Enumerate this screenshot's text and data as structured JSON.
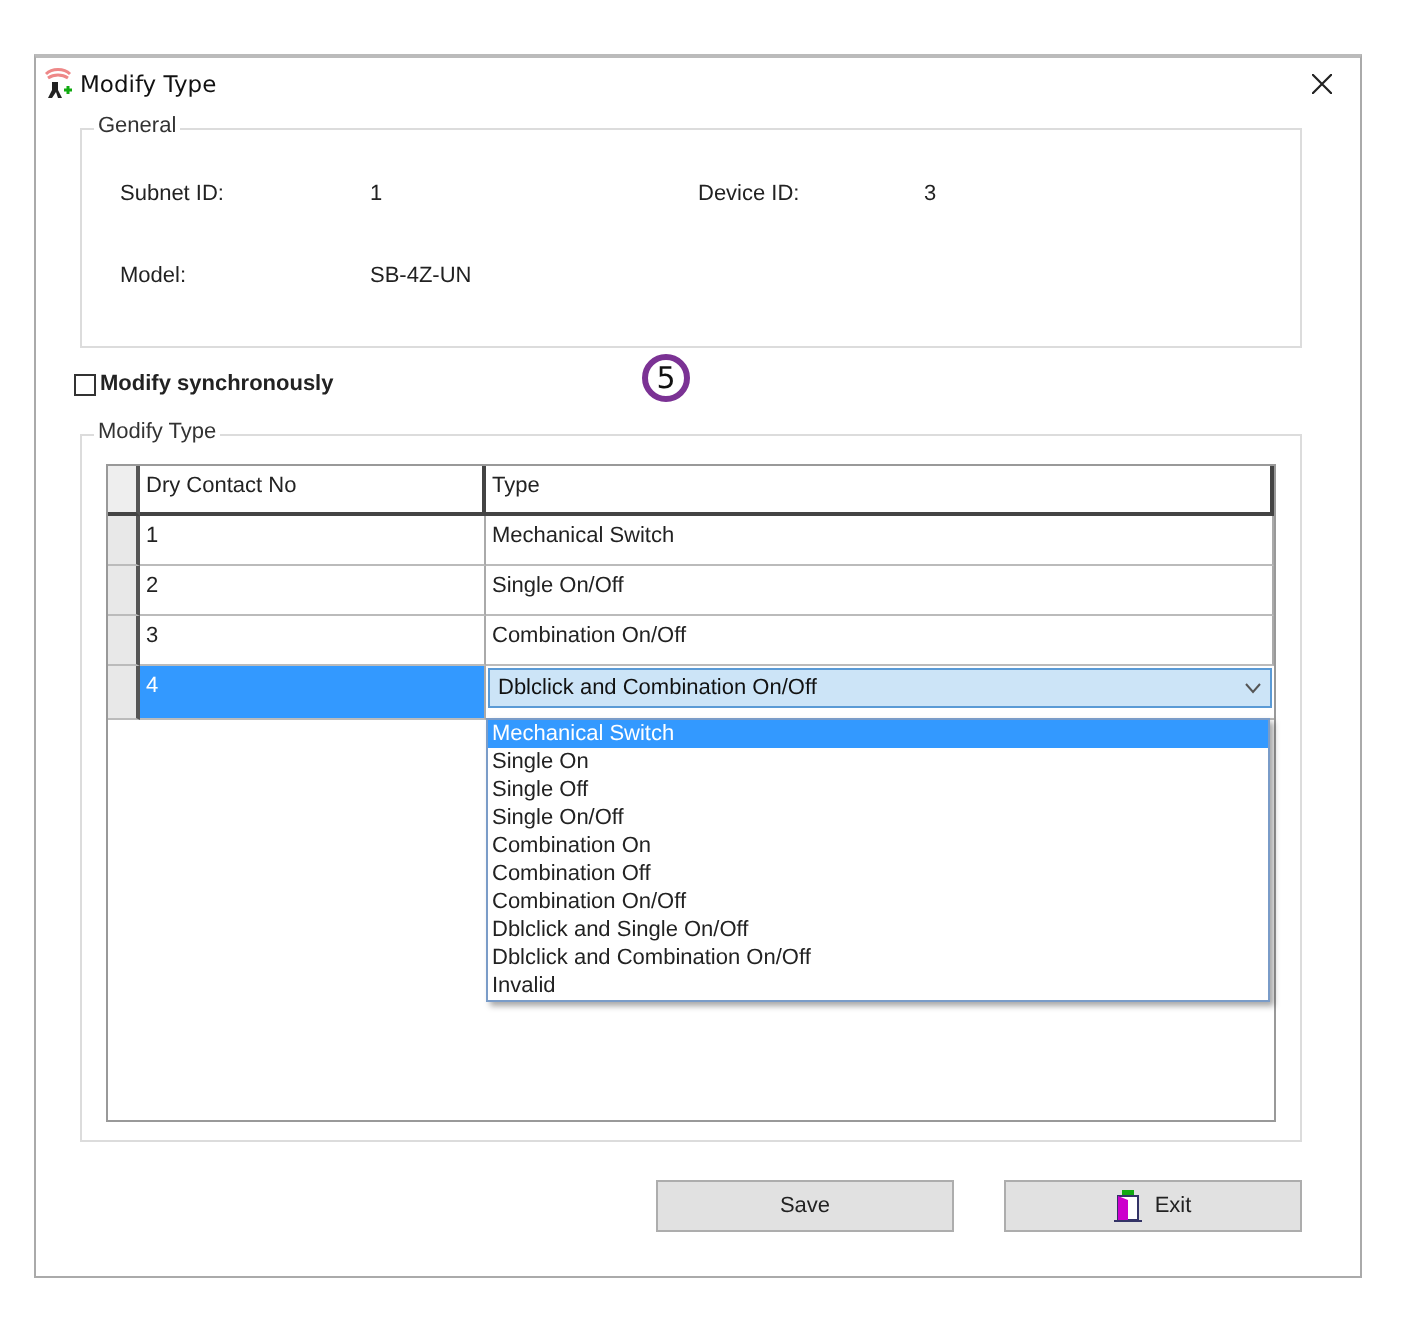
{
  "window": {
    "title": "Modify Type"
  },
  "general": {
    "title": "General",
    "fields": [
      {
        "label": "Subnet ID:",
        "value": "1"
      },
      {
        "label": "Device ID:",
        "value": "3"
      },
      {
        "label": "Model:",
        "value": "SB-4Z-UN"
      }
    ]
  },
  "modify_synchronously": {
    "label": "Modify synchronously",
    "checked": false
  },
  "step_badge": "5",
  "modify_type": {
    "title": "Modify Type",
    "columns": [
      "Dry Contact No",
      "Type"
    ],
    "rows": [
      {
        "no": "1",
        "type": "Mechanical Switch",
        "selected": false
      },
      {
        "no": "2",
        "type": "Single On/Off",
        "selected": false
      },
      {
        "no": "3",
        "type": "Combination On/Off",
        "selected": false
      },
      {
        "no": "4",
        "type": "Dblclick and Combination On/Off",
        "selected": true
      }
    ],
    "dropdown": [
      {
        "label": "Mechanical Switch",
        "selected": true
      },
      {
        "label": "Single On",
        "selected": false
      },
      {
        "label": "Single Off",
        "selected": false
      },
      {
        "label": "Single On/Off",
        "selected": false
      },
      {
        "label": "Combination On",
        "selected": false
      },
      {
        "label": "Combination Off",
        "selected": false
      },
      {
        "label": "Combination On/Off",
        "selected": false
      },
      {
        "label": "Dblclick and Single On/Off",
        "selected": false
      },
      {
        "label": "Dblclick and Combination On/Off",
        "selected": false
      },
      {
        "label": "Invalid",
        "selected": false
      }
    ]
  },
  "buttons": [
    {
      "label": "Save",
      "kind": "plain"
    },
    {
      "label": "Exit",
      "kind": "exit"
    }
  ]
}
